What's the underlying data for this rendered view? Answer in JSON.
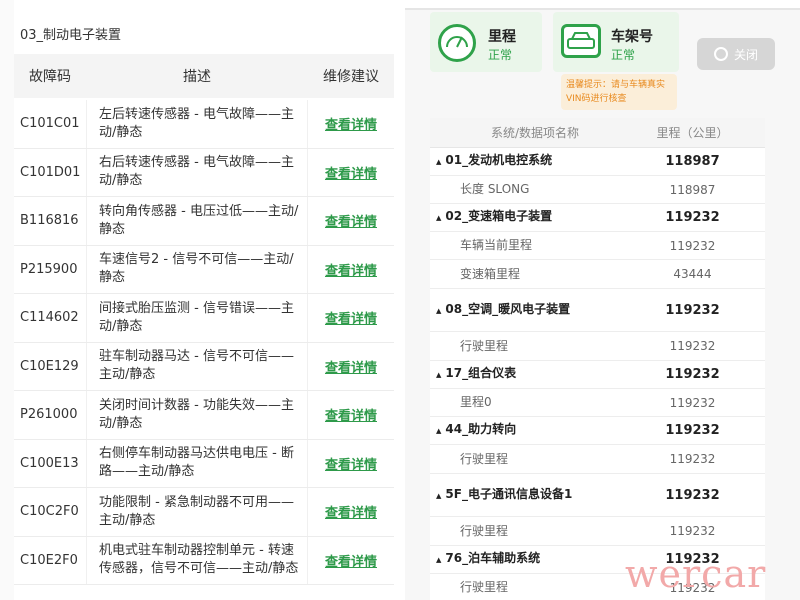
{
  "left": {
    "section_title": "03_制动电子装置",
    "headers": {
      "code": "故障码",
      "desc": "描述",
      "advice": "维修建议"
    },
    "rows": [
      {
        "code": "C101C01",
        "desc": "左后转速传感器 - 电气故障——主动/静态",
        "advice": "查看详情"
      },
      {
        "code": "C101D01",
        "desc": "右后转速传感器 - 电气故障——主动/静态",
        "advice": "查看详情"
      },
      {
        "code": "B116816",
        "desc": "转向角传感器 - 电压过低——主动/静态",
        "advice": "查看详情"
      },
      {
        "code": "P215900",
        "desc": "车速信号2 - 信号不可信——主动/静态",
        "advice": "查看详情"
      },
      {
        "code": "C114602",
        "desc": "间接式胎压监测 - 信号错误——主动/静态",
        "advice": "查看详情"
      },
      {
        "code": "C10E129",
        "desc": "驻车制动器马达 - 信号不可信——主动/静态",
        "advice": "查看详情"
      },
      {
        "code": "P261000",
        "desc": "关闭时间计数器 - 功能失效——主动/静态",
        "advice": "查看详情"
      },
      {
        "code": "C100E13",
        "desc": "右侧停车制动器马达供电电压 - 断路——主动/静态",
        "advice": "查看详情"
      },
      {
        "code": "C10C2F0",
        "desc": "功能限制 - 紧急制动器不可用——主动/静态",
        "advice": "查看详情"
      },
      {
        "code": "C10E2F0",
        "desc": "机电式驻车制动器控制单元 - 转速传感器，信号不可信——主动/静态",
        "advice": "查看详情"
      }
    ]
  },
  "right": {
    "mileage_card": {
      "label": "里程",
      "status": "正常",
      "icon": "speedometer-icon"
    },
    "vin_card": {
      "label": "车架号",
      "status": "正常",
      "icon": "vin-car-icon"
    },
    "warning": "温馨提示：请与车辆真实VIN码进行核查",
    "close_button": "关闭",
    "table_headers": {
      "name": "系统/数据项名称",
      "value": "里程（公里）"
    },
    "rows": [
      {
        "type": "group",
        "name": "01_发动机电控系统",
        "value": "118987"
      },
      {
        "type": "sub",
        "name": "长度 SLONG",
        "value": "118987"
      },
      {
        "type": "group",
        "name": "02_变速箱电子装置",
        "value": "119232"
      },
      {
        "type": "sub",
        "name": "车辆当前里程",
        "value": "119232"
      },
      {
        "type": "sub",
        "name": "变速箱里程",
        "value": "43444"
      },
      {
        "type": "group",
        "name": "08_空调_暖风电子装置",
        "value": "119232"
      },
      {
        "type": "sub",
        "name": "行驶里程",
        "value": "119232"
      },
      {
        "type": "group",
        "name": "17_组合仪表",
        "value": "119232"
      },
      {
        "type": "sub",
        "name": "里程0",
        "value": "119232"
      },
      {
        "type": "group",
        "name": "44_助力转向",
        "value": "119232"
      },
      {
        "type": "sub",
        "name": "行驶里程",
        "value": "119232"
      },
      {
        "type": "group",
        "name": "5F_电子通讯信息设备1",
        "value": "119232"
      },
      {
        "type": "sub",
        "name": "行驶里程",
        "value": "119232"
      },
      {
        "type": "group",
        "name": "76_泊车辅助系统",
        "value": "119232"
      },
      {
        "type": "sub",
        "name": "行驶里程",
        "value": "119232"
      }
    ],
    "watermark": "wercar"
  },
  "colors": {
    "accent_green": "#2fa24a",
    "warning_orange": "#e88a1e",
    "link_green": "#2e9a4a"
  }
}
